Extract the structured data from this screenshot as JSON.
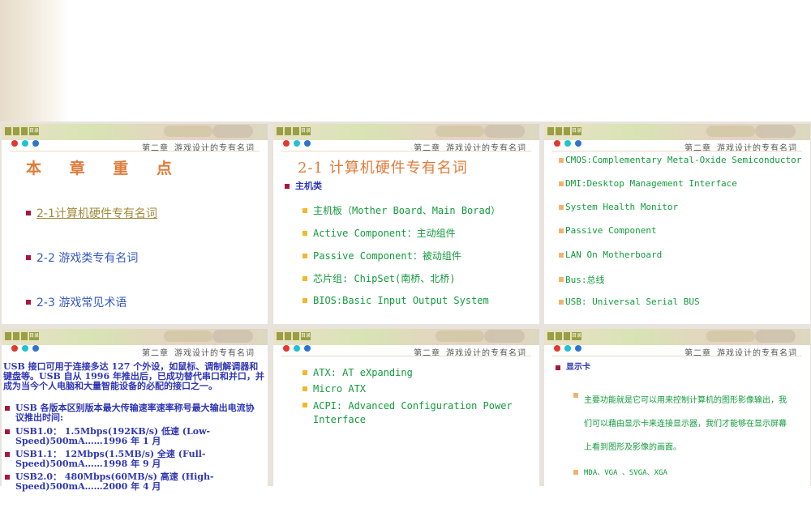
{
  "chapter_header": "第二章 游戏设计的专有名词",
  "nav_labels": [
    "",
    "",
    "",
    "目录"
  ],
  "slides": {
    "s1": {
      "title": "本 章 重 点",
      "items": [
        "2-1计算机硬件专有名词",
        "2-2  游戏类专有名词",
        "2-3  游戏常见术语"
      ]
    },
    "s2": {
      "title": "2-1  计算机硬件专有名词",
      "heading": "主机类",
      "items": [
        "主机板（Mother Board、Main Borad）",
        "Active Component：主动组件",
        "Passive Component：被动组件",
        "芯片组: ChipSet(南桥、北桥)",
        " BIOS:Basic Input Output System"
      ]
    },
    "s3": {
      "items": [
        "CMOS:Complementary Metal-Oxide Semiconductor",
        "DMI:Desktop Management Interface",
        "System Health Monitor",
        "Passive Component",
        "LAN On Motherboard",
        "Bus:总线",
        "USB: Universal Serial BUS"
      ]
    },
    "s4": {
      "intro": "USB 接口可用于连接多达 127 个外设，如鼠标、调制解调器和键盘等。USB 自从 1996 年推出后，已成功替代串口和并口，并成为当今个人电脑和大量智能设备的必配的接口之一。",
      "items": [
        "USB 各版本区别版本最大传输速率速率称号最大输出电流协议推出时间:",
        "USB1.0： 1.5Mbps(192KB/s) 低速 (Low-Speed)500mA……1996 年 1 月",
        "USB1.1： 12Mbps(1.5MB/s) 全速 (Full-Speed)500mA……1998 年 9 月",
        "USB2.0： 480Mbps(60MB/s) 高速 (High-Speed)500mA……2000 年 4 月"
      ]
    },
    "s5": {
      "items": [
        "ATX: AT eXpanding",
        "Micro ATX",
        "ACPI: Advanced Configuration Power Interface"
      ]
    },
    "s6": {
      "heading": "显示卡",
      "paragraph": "主要功能就是它可以用来控制计算机的图形影像输出，我们可以藉由显示卡来连接显示器，我们才能够在显示屏幕上看到图形及影像的画面。",
      "item": "MDA、VGA 、SVGA、XGA"
    }
  }
}
